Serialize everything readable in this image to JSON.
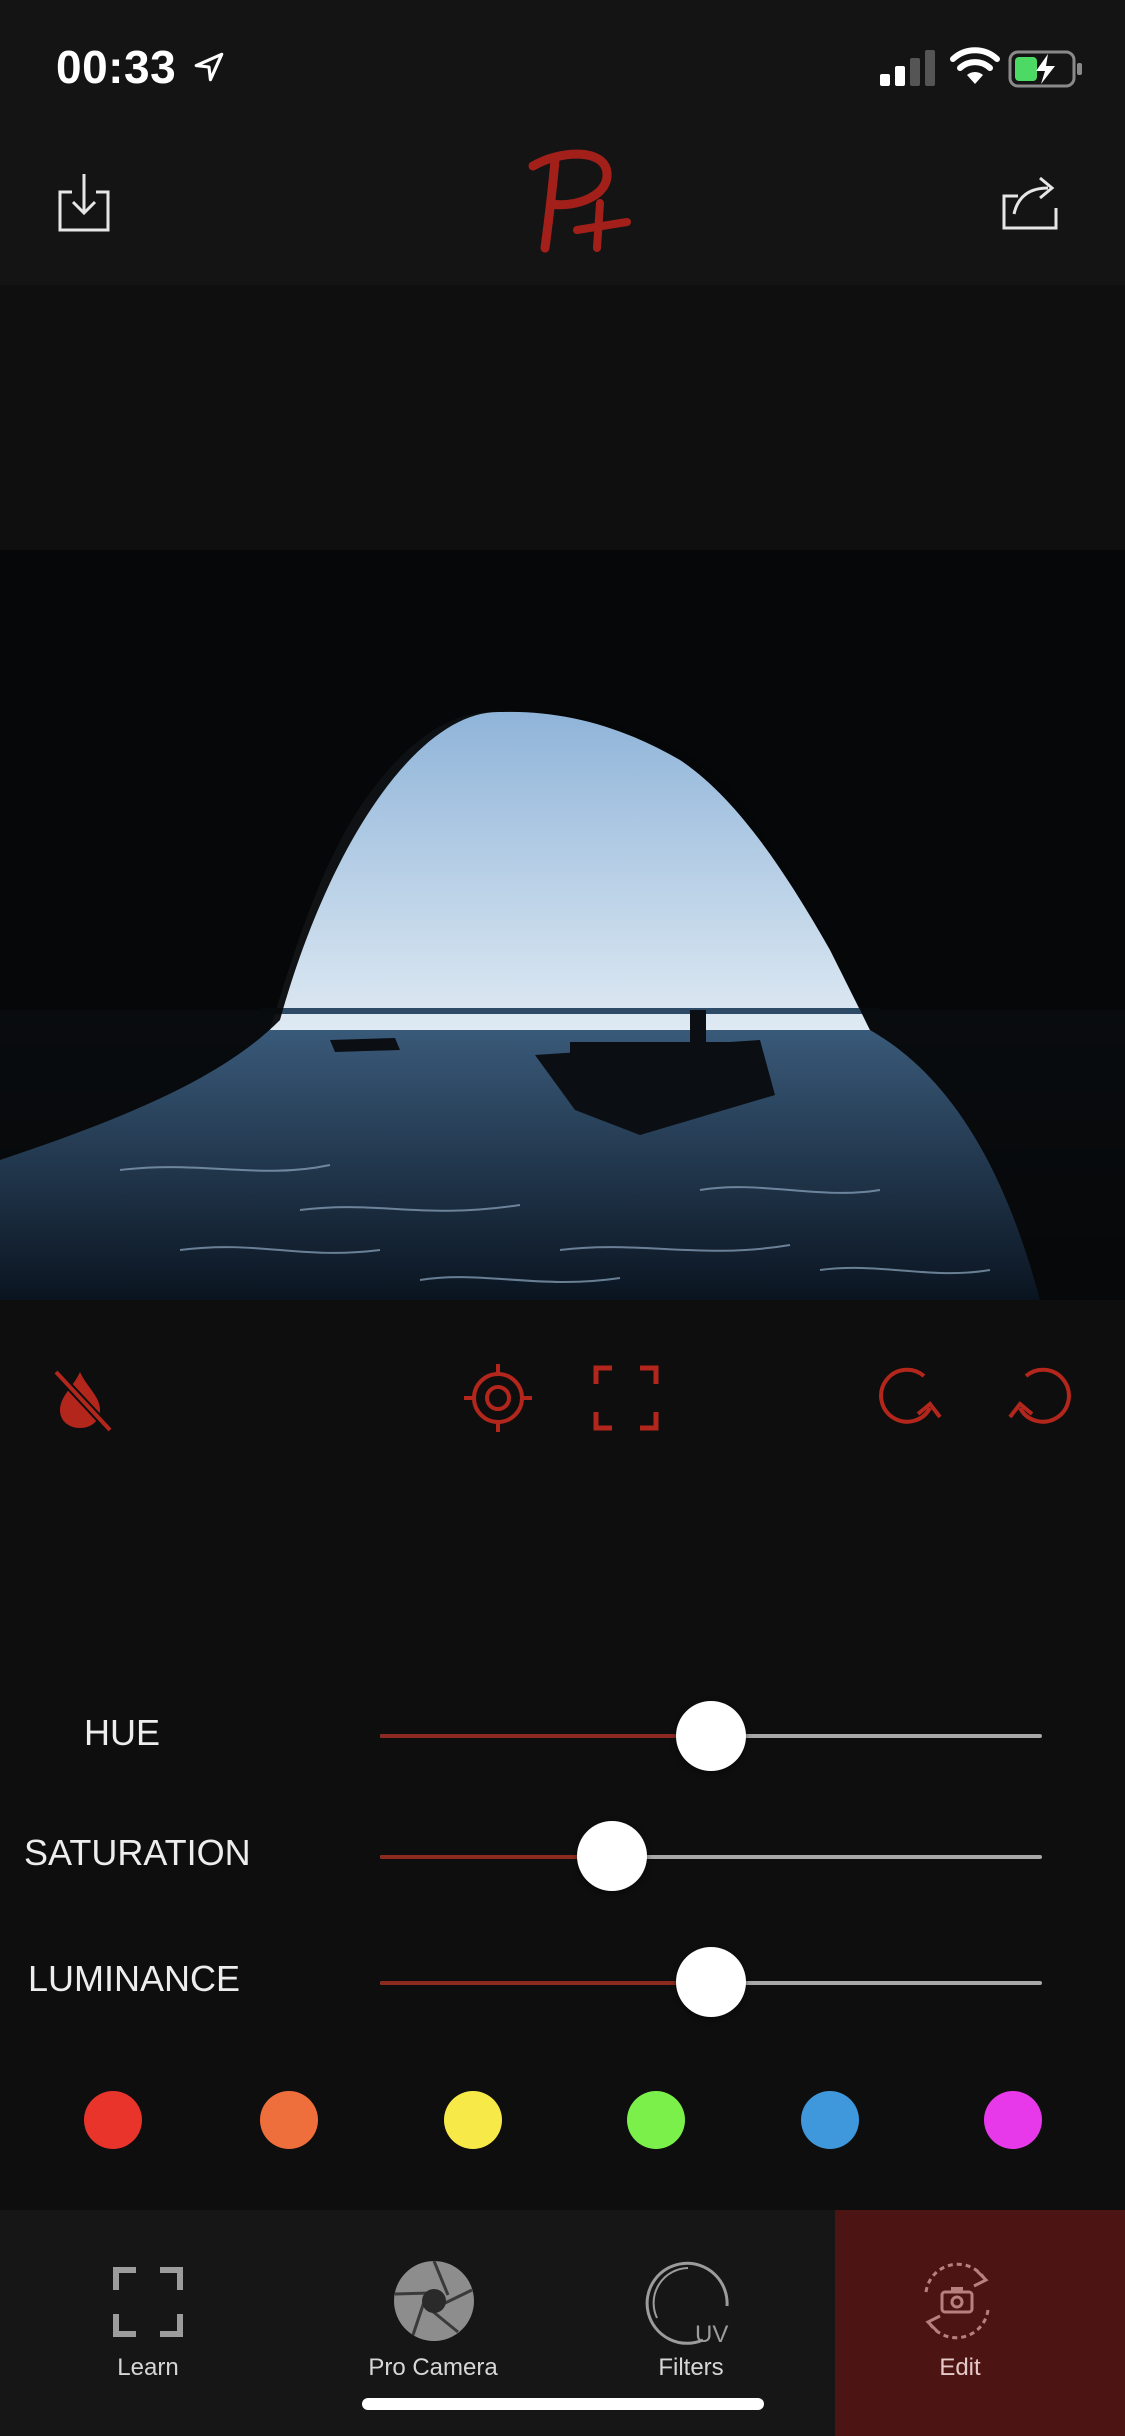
{
  "status_bar": {
    "time": "00:33",
    "icons": [
      "location-arrow-icon",
      "cellular-signal-icon",
      "wifi-icon",
      "battery-charging-icon"
    ]
  },
  "toolbar": {
    "logo_text": "P+",
    "left_icon": "save-to-device-icon",
    "right_icon": "share-icon"
  },
  "colors": {
    "accent": "#b3261c",
    "background": "#0e0e0e",
    "active_tab": "#4c1413"
  },
  "tools": {
    "icons": [
      "no-color-drop-icon",
      "target-icon",
      "selection-frame-icon",
      "redo-icon",
      "undo-icon"
    ]
  },
  "sliders": [
    {
      "label": "HUE",
      "value": 0.5
    },
    {
      "label": "SATURATION",
      "value": 0.35
    },
    {
      "label": "LUMINANCE",
      "value": 0.5
    }
  ],
  "color_swatches": [
    "#e8342b",
    "#ef6f3c",
    "#f7ea48",
    "#7bf04b",
    "#3f98dc",
    "#e739e9"
  ],
  "tabs": [
    {
      "label": "Learn",
      "icon": "learn-frame-icon",
      "active": false
    },
    {
      "label": "Pro Camera",
      "icon": "aperture-icon",
      "active": false
    },
    {
      "label": "Filters",
      "icon": "uv-filter-icon",
      "active": false
    },
    {
      "label": "Edit",
      "icon": "edit-rotate-camera-icon",
      "active": true
    }
  ]
}
